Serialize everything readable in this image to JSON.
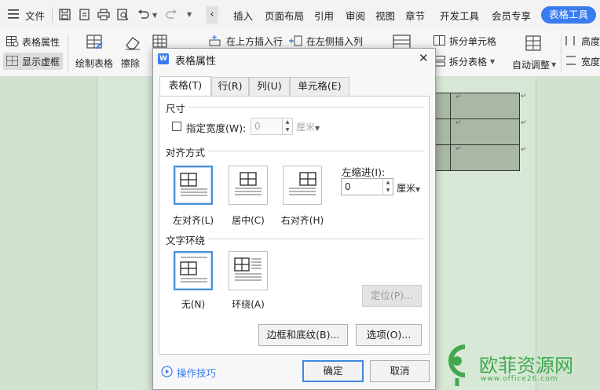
{
  "menubar": {
    "file_label": "文件",
    "tabs": [
      "插入",
      "页面布局",
      "引用",
      "审阅",
      "视图",
      "章节",
      "开发工具",
      "会员专享"
    ],
    "active_tab": "表格工具"
  },
  "ribbon": {
    "table_props": "表格属性",
    "show_gridlines": "显示虚框",
    "draw_table": "绘制表格",
    "erase": "擦除",
    "insert_above": "在上方插入行",
    "insert_left": "在左侧插入列",
    "split_cells": "拆分单元格",
    "split_table": "拆分表格",
    "auto_fit": "自动调整",
    "height": "高度",
    "width": "宽度"
  },
  "document": {
    "cell_mark": "↵"
  },
  "dialog": {
    "title": "表格属性",
    "close": "✕",
    "tabs": [
      "表格(T)",
      "行(R)",
      "列(U)",
      "单元格(E)"
    ],
    "size_section": "尺寸",
    "specify_width_label": "指定宽度(W):",
    "width_value": "0",
    "width_unit": "厘米",
    "align_section": "对齐方式",
    "align_options": [
      "左对齐(L)",
      "居中(C)",
      "右对齐(H)"
    ],
    "indent_label": "左缩进(I):",
    "indent_value": "0",
    "indent_unit": "厘米",
    "wrap_section": "文字环绕",
    "wrap_options": [
      "无(N)",
      "环绕(A)"
    ],
    "position_button": "定位(P)...",
    "borders_button": "边框和底纹(B)...",
    "options_button": "选项(O)...",
    "tips_link": "操作技巧",
    "ok_button": "确定",
    "cancel_button": "取消"
  },
  "watermark": {
    "text": "欧菲资源网",
    "url": "www.office26.com"
  },
  "colors": {
    "accent": "#3a7bf0",
    "doc_background": "#cfe3cf",
    "selected_border": "#4a90d9",
    "watermark": "#42a84e"
  }
}
